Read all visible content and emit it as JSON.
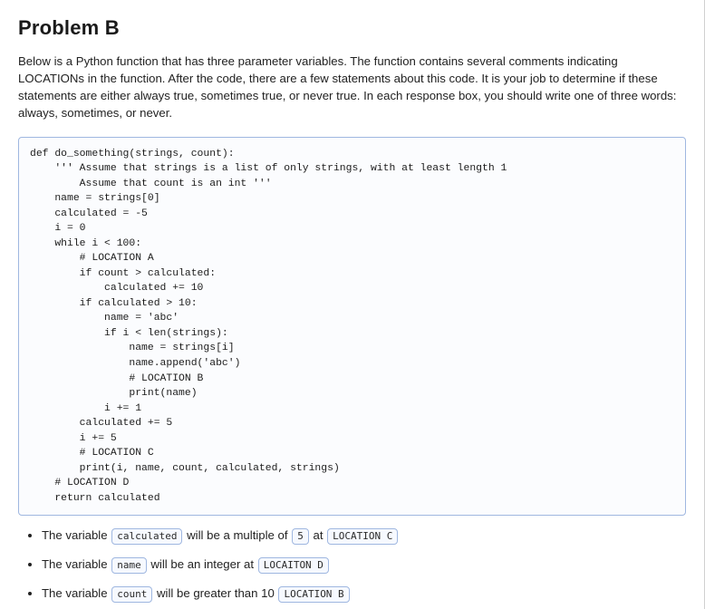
{
  "problem": {
    "title": "Problem B",
    "description": "Below is a Python function that has three parameter variables. The function contains several comments indicating LOCATIONs in the function. After the code, there are a few statements about this code. It is your job to determine if these statements are either always true, sometimes true, or never true. In each response box, you should write one of three words: always, sometimes, or never."
  },
  "code": "def do_something(strings, count):\n    ''' Assume that strings is a list of only strings, with at least length 1\n        Assume that count is an int '''\n    name = strings[0]\n    calculated = -5\n    i = 0\n    while i < 100:\n        # LOCATION A\n        if count > calculated:\n            calculated += 10\n        if calculated > 10:\n            name = 'abc'\n            if i < len(strings):\n                name = strings[i]\n                name.append('abc')\n                # LOCATION B\n                print(name)\n            i += 1\n        calculated += 5\n        i += 5\n        # LOCATION C\n        print(i, name, count, calculated, strings)\n    # LOCATION D\n    return calculated",
  "statements": [
    {
      "pre": "The variable ",
      "var": "calculated",
      "mid": " will be a multiple of ",
      "num": "5",
      "mid2": " at ",
      "loc": "LOCATION C"
    },
    {
      "pre": "The variable ",
      "var": "name",
      "mid": " will be an integer at ",
      "loc": "LOCAITON D"
    },
    {
      "pre": "The variable ",
      "var": "count",
      "mid": " will be greater than 10 ",
      "loc": "LOCATION B"
    }
  ]
}
